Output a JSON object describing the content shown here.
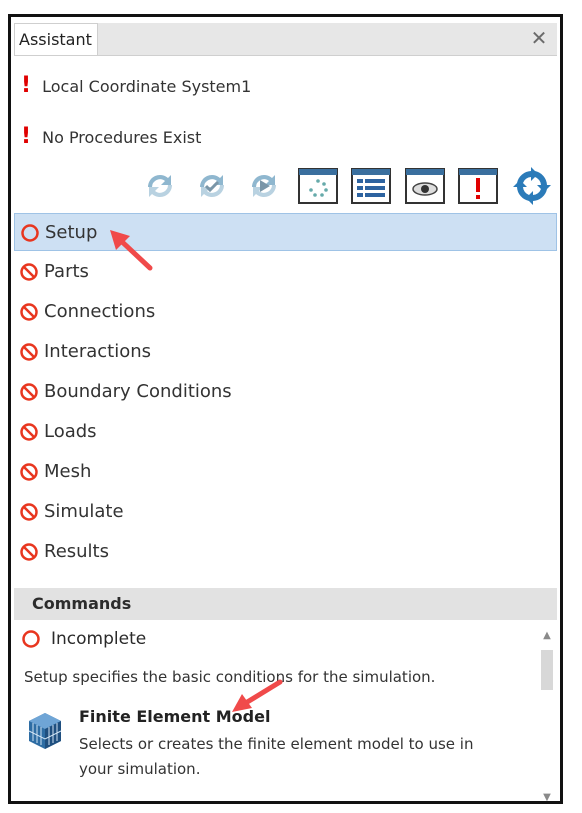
{
  "window": {
    "tab_title": "Assistant",
    "close_label": "✕"
  },
  "alerts": [
    {
      "text": "Local Coordinate System1"
    },
    {
      "text": "No Procedures Exist"
    }
  ],
  "toolbar": {
    "icons": [
      "refresh-icon",
      "refresh-check-icon",
      "refresh-play-icon",
      "loading-window-icon",
      "list-view-icon",
      "preview-eye-icon",
      "alert-window-icon",
      "sync-arrows-icon"
    ]
  },
  "steps": [
    {
      "label": "Setup",
      "status": "incomplete",
      "selected": true
    },
    {
      "label": "Parts",
      "status": "blocked"
    },
    {
      "label": "Connections",
      "status": "blocked"
    },
    {
      "label": "Interactions",
      "status": "blocked"
    },
    {
      "label": "Boundary Conditions",
      "status": "blocked"
    },
    {
      "label": "Loads",
      "status": "blocked"
    },
    {
      "label": "Mesh",
      "status": "blocked"
    },
    {
      "label": "Simulate",
      "status": "blocked"
    },
    {
      "label": "Results",
      "status": "blocked"
    }
  ],
  "commands": {
    "header": "Commands",
    "status_label": "Incomplete",
    "description": "Setup specifies the basic conditions for the simulation.",
    "item": {
      "title": "Finite Element Model",
      "subtitle": "Selects or creates the finite element model to use in your simulation."
    }
  },
  "colors": {
    "incomplete": "#e8361f",
    "blocked": "#e8361f",
    "selected_bg": "#cde0f3",
    "annotation_arrow": "#f04a4a"
  }
}
